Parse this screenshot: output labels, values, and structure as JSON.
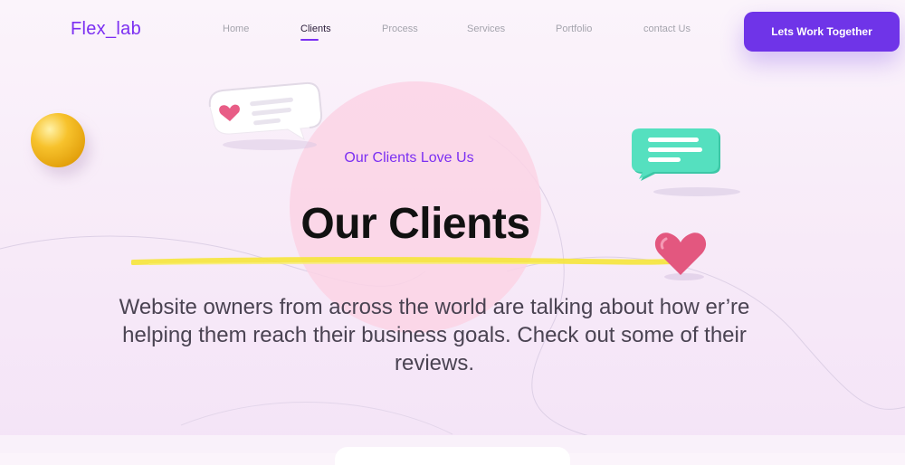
{
  "brand": {
    "logo_text": "Flex_lab",
    "accent_color": "#7b2ff2"
  },
  "nav": {
    "items": [
      {
        "label": "Home",
        "active": false
      },
      {
        "label": "Clients",
        "active": true
      },
      {
        "label": "Process",
        "active": false
      },
      {
        "label": "Services",
        "active": false
      },
      {
        "label": "Portfolio",
        "active": false
      },
      {
        "label": "contact Us",
        "active": false
      }
    ],
    "cta_label": "Lets Work Together"
  },
  "hero": {
    "kicker": "Our Clients Love Us",
    "title": "Our Clients",
    "description": "Website owners from across the world are talking about how er’re helping them reach their business goals. Check out some of their reviews."
  },
  "decorations": {
    "icons": [
      "yellow-ball-icon",
      "heart-chat-bubble-icon",
      "green-chat-bubble-icon",
      "heart-icon",
      "brush-stroke-icon"
    ],
    "colors": {
      "heart": "#e85d86",
      "green_bubble": "#46d8b6",
      "brush": "#f5e53a",
      "pink_circle": "#fbd3e5",
      "cta": "#6f34e8"
    }
  }
}
